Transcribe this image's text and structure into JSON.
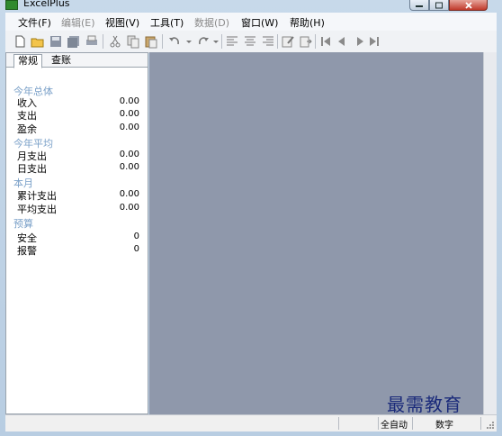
{
  "window": {
    "title": "ExcelPlus",
    "icon": "excel-app-icon"
  },
  "menu": [
    {
      "label": "文件(F)",
      "enabled": true
    },
    {
      "label": "编辑(E)",
      "enabled": false
    },
    {
      "label": "视图(V)",
      "enabled": true
    },
    {
      "label": "工具(T)",
      "enabled": true
    },
    {
      "label": "数据(D)",
      "enabled": false
    },
    {
      "label": "窗口(W)",
      "enabled": true
    },
    {
      "label": "帮助(H)",
      "enabled": true
    }
  ],
  "toolbar": {
    "buttons": [
      "new-icon",
      "open-icon",
      "save-icon",
      "save-all-icon",
      "print-icon",
      "cut-icon",
      "copy-icon",
      "paste-icon",
      "undo-icon",
      "redo-icon",
      "align-left-icon",
      "align-center-icon",
      "align-right-icon",
      "edit-icon",
      "export-icon",
      "first-icon",
      "prev-icon",
      "next-icon",
      "last-icon"
    ]
  },
  "panel": {
    "tabs": [
      "常规",
      "查账"
    ],
    "active_tab": 0,
    "sections": [
      {
        "title": "今年总体",
        "rows": [
          {
            "label": "收入",
            "value": "0.00"
          },
          {
            "label": "支出",
            "value": "0.00"
          },
          {
            "label": "盈余",
            "value": "0.00"
          }
        ]
      },
      {
        "title": "今年平均",
        "rows": [
          {
            "label": "月支出",
            "value": "0.00"
          },
          {
            "label": "日支出",
            "value": "0.00"
          }
        ]
      },
      {
        "title": "本月",
        "rows": [
          {
            "label": "累计支出",
            "value": "0.00"
          },
          {
            "label": "平均支出",
            "value": "0.00"
          }
        ]
      },
      {
        "title": "预算",
        "rows": [
          {
            "label": "安全",
            "value": "0"
          },
          {
            "label": "报警",
            "value": "0"
          }
        ]
      }
    ]
  },
  "status": {
    "mode": "全自动",
    "numlock": "数字"
  },
  "watermark": "最需教育",
  "colors": {
    "workspace": "#8f98ab",
    "section_title": "#7aa0c8"
  }
}
